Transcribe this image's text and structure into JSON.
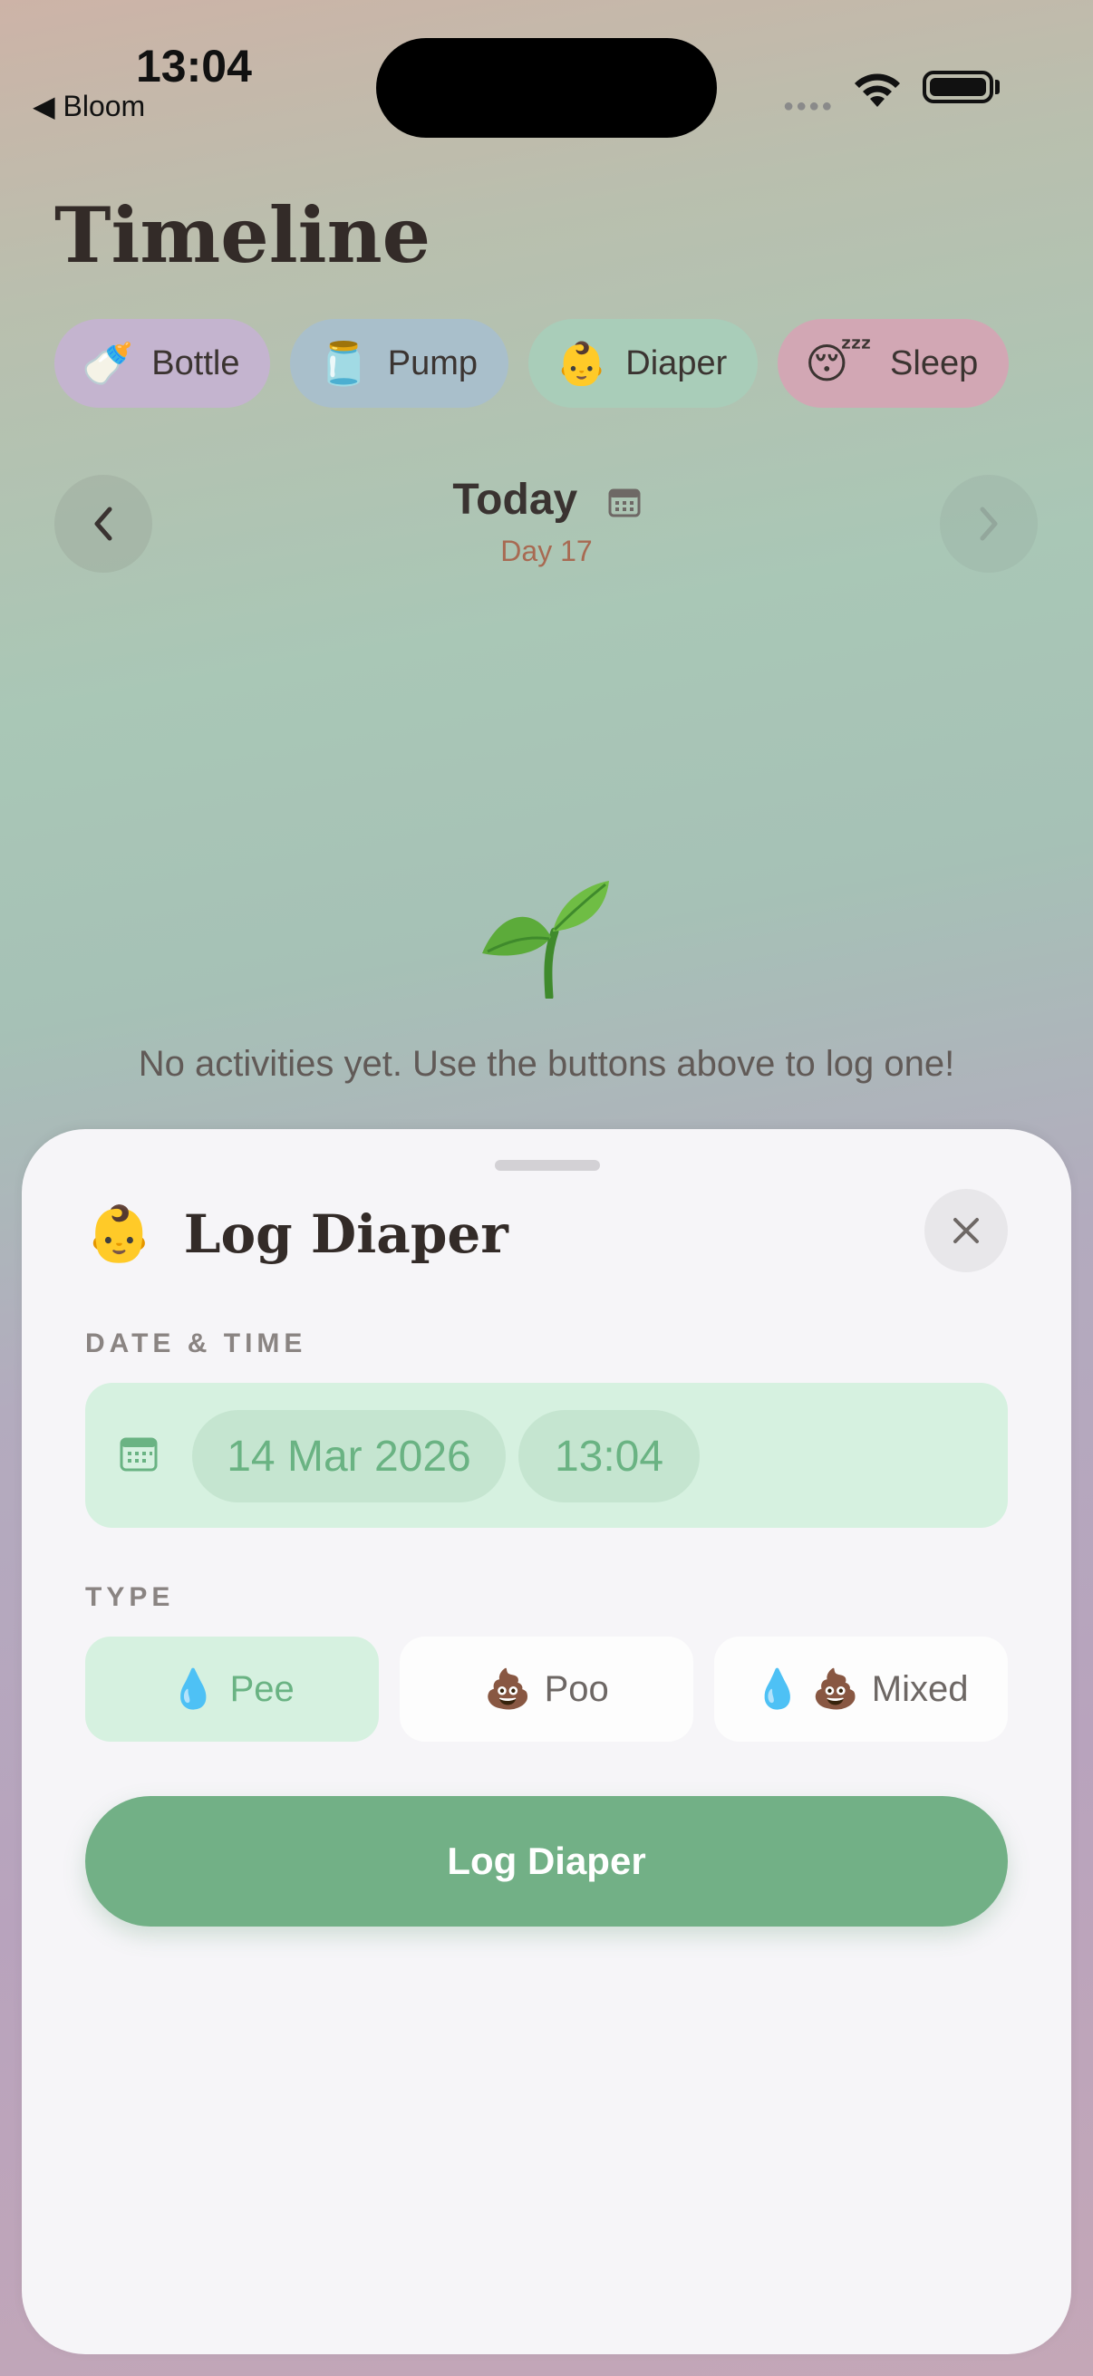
{
  "status": {
    "time": "13:04",
    "back_app": "◀ Bloom"
  },
  "page": {
    "title": "Timeline"
  },
  "quick_actions": [
    {
      "icon": "🍼",
      "label": "Bottle"
    },
    {
      "icon": "🫙",
      "label": "Pump"
    },
    {
      "icon": "👶",
      "label": "Diaper"
    },
    {
      "icon": "😴",
      "label": "Sleep"
    }
  ],
  "date_nav": {
    "title": "Today",
    "subtitle": "Day 17"
  },
  "empty_state": {
    "icon": "🌱",
    "message": "No activities yet. Use the buttons above to log one!"
  },
  "sheet": {
    "icon": "👶",
    "title": "Log Diaper",
    "date_time_label": "DATE & TIME",
    "date_value": "14 Mar 2026",
    "time_value": "13:04",
    "type_label": "TYPE",
    "types": [
      {
        "icon": "💧",
        "label": "Pee",
        "selected": true
      },
      {
        "icon": "💩",
        "label": "Poo",
        "selected": false
      },
      {
        "icon": "💧 💩",
        "label": "Mixed",
        "selected": false
      }
    ],
    "submit_label": "Log Diaper"
  },
  "colors": {
    "accent": "#72b086",
    "selected_bg": "#d6f1e0",
    "day_text": "#a86a52"
  }
}
